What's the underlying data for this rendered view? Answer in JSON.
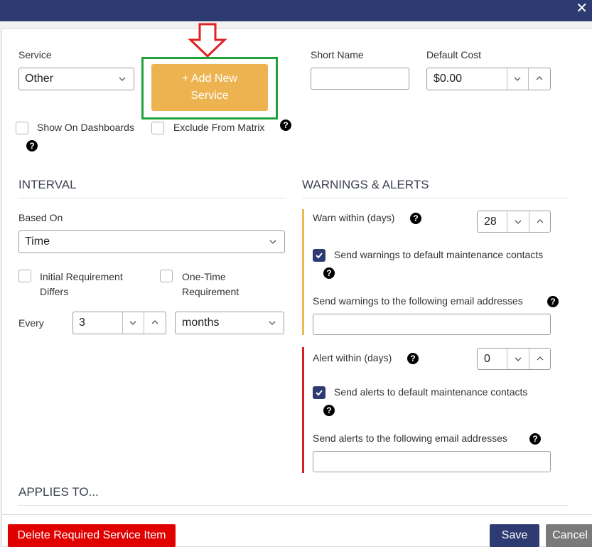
{
  "window": {
    "close_label": "✕"
  },
  "service": {
    "label": "Service",
    "value": "Other",
    "add_button": "+ Add New Service",
    "short_name_label": "Short Name",
    "short_name_value": "",
    "default_cost_label": "Default Cost",
    "default_cost_value": "$0.00",
    "show_on_dashboards": "Show On Dashboards",
    "exclude_from_matrix": "Exclude From Matrix"
  },
  "interval": {
    "heading": "INTERVAL",
    "based_on_label": "Based On",
    "based_on_value": "Time",
    "initial_requirement": "Initial Requirement Differs",
    "one_time": "One-Time Requirement",
    "every_label": "Every",
    "every_value": "3",
    "unit_value": "months"
  },
  "warnings": {
    "heading": "WARNINGS & ALERTS",
    "warn_within_label": "Warn within (days)",
    "warn_within_value": "28",
    "send_warnings_default": "Send warnings to default maintenance contacts",
    "send_warnings_emails_label": "Send warnings to the following email addresses",
    "alert_within_label": "Alert within (days)",
    "alert_within_value": "0",
    "send_alerts_default": "Send alerts to default maintenance contacts",
    "send_alerts_emails_label": "Send alerts to the following email addresses"
  },
  "applies_to": {
    "heading": "APPLIES TO..."
  },
  "footer": {
    "delete_label": "Delete Required Service Item",
    "save_label": "Save",
    "cancel_label": "Cancel"
  },
  "icons": {
    "help": "?",
    "check": "check-icon",
    "chevron": "chevron-down-icon",
    "arrow": "down-arrow-icon"
  },
  "colors": {
    "titlebar": "#2e3a72",
    "add_button": "#ecb350",
    "highlight_border": "#22a33a",
    "arrow": "#e02222",
    "warn_bar": "#f0b85a",
    "alert_bar": "#d62020",
    "delete_button": "#e00000",
    "save_button": "#2e3a72",
    "cancel_button": "#7a7a7a"
  }
}
